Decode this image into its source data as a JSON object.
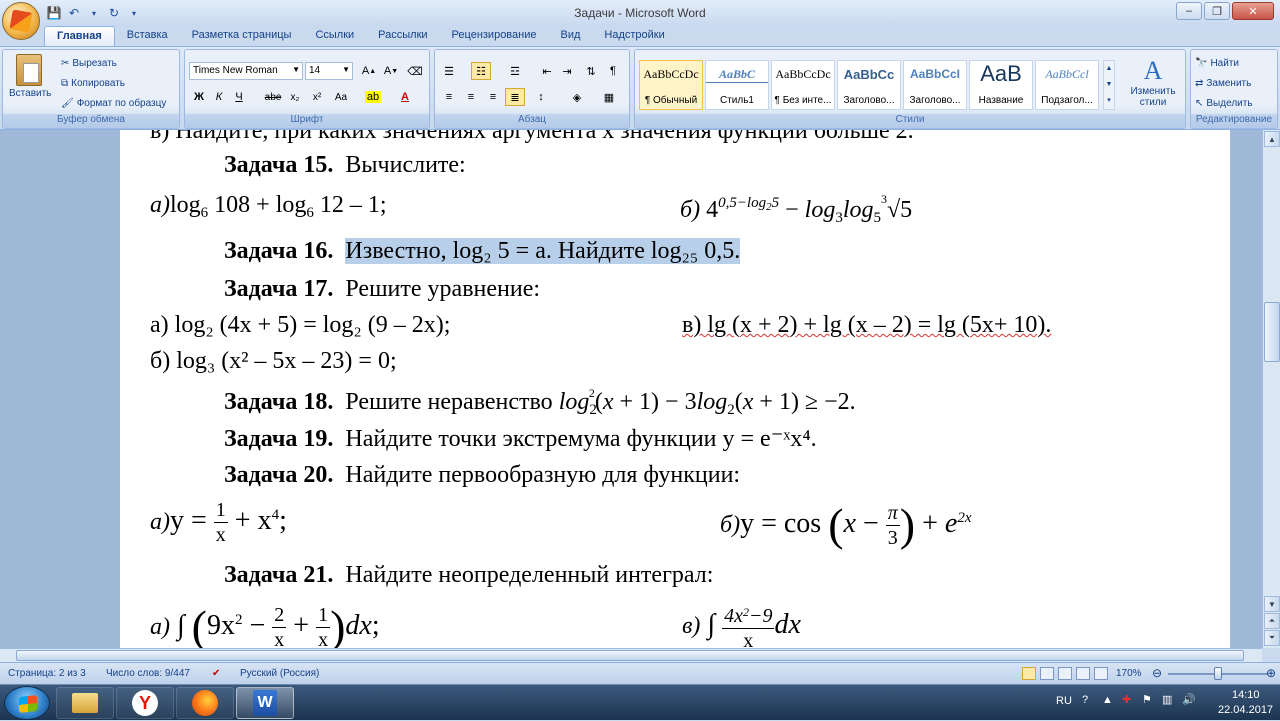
{
  "window": {
    "title": "Задачи - Microsoft Word",
    "minimize": "–",
    "restore": "❐",
    "close": "✕"
  },
  "tabs": [
    "Главная",
    "Вставка",
    "Разметка страницы",
    "Ссылки",
    "Рассылки",
    "Рецензирование",
    "Вид",
    "Надстройки"
  ],
  "ribbon": {
    "clipboard": {
      "label": "Буфер обмена",
      "paste": "Вставить",
      "cut": "Вырезать",
      "copy": "Копировать",
      "format_painter": "Формат по образцу"
    },
    "font": {
      "label": "Шрифт",
      "font_name": "Times New Roman",
      "font_size": "14",
      "bold": "Ж",
      "italic": "К",
      "underline": "Ч",
      "strike": "abe",
      "subscript": "x₂",
      "superscript": "x²",
      "case": "Aa"
    },
    "paragraph": {
      "label": "Абзац"
    },
    "styles": {
      "label": "Стили",
      "items": [
        {
          "sample": "AaBbCcDc",
          "name": "¶ Обычный"
        },
        {
          "sample": "AaBbC",
          "name": "Стиль1"
        },
        {
          "sample": "AaBbCcDc",
          "name": "¶ Без инте..."
        },
        {
          "sample": "AaBbCc",
          "name": "Заголово..."
        },
        {
          "sample": "AaBbCcI",
          "name": "Заголово..."
        },
        {
          "sample": "AaB",
          "name": "Название"
        },
        {
          "sample": "AaBbCcl",
          "name": "Подзагол..."
        }
      ],
      "change": "Изменить стили"
    },
    "editing": {
      "label": "Редактирование",
      "find": "Найти",
      "replace": "Заменить",
      "select": "Выделить"
    }
  },
  "document": {
    "line_top": "в) Найдите, при каких значениях аргумента x значения функции больше 2.",
    "z15": {
      "label": "Задача 15.",
      "text": "Вычислите:"
    },
    "z15_a": "а)",
    "z15_b": "б)",
    "z16": {
      "label": "Задача 16.",
      "text": "Известно, log₂ 5 = a. Найдите log₂₅ 0,5."
    },
    "z17": {
      "label": "Задача 17.",
      "text": "Решите уравнение:"
    },
    "z17_a": "а) log₂ (4x + 5) = log₂ (9 – 2x);",
    "z17_v": "в) lg (x + 2) + lg (x – 2) = lg (5x+ 10).",
    "z17_b": "б) log₃ (x² – 5x – 23) = 0;",
    "z18": {
      "label": "Задача 18.",
      "text": "Решите неравенство"
    },
    "z19": {
      "label": "Задача 19.",
      "text": "Найдите точки экстремума функции y = e⁻ˣx⁴."
    },
    "z20": {
      "label": "Задача 20.",
      "text": "Найдите первообразную для функции:"
    },
    "z21": {
      "label": "Задача 21.",
      "text": "Найдите неопределенный интеграл:"
    }
  },
  "status": {
    "page": "Страница: 2 из 3",
    "words": "Число слов: 9/447",
    "language": "Русский (Россия)",
    "zoom": "170%"
  },
  "taskbar": {
    "lang": "RU",
    "time": "14:10",
    "date": "22.04.2017"
  }
}
